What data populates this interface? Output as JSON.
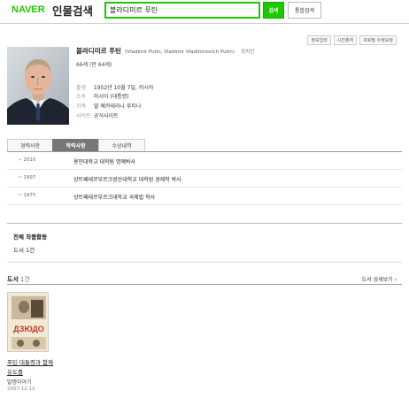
{
  "header": {
    "logo": "NAVER",
    "service": "인물검색",
    "search_value": "블라디미르 푸틴",
    "search_button": "검색",
    "total_button": "통합검색"
  },
  "top_links": [
    "정보입력",
    "시진출처",
    "프로필 수정요청"
  ],
  "profile": {
    "name": "블라디미르 푸틴",
    "name_en": "(Vladimir Putin, Vladimir Vladimirovich Putin)",
    "job": "정치인",
    "age": "66세 (만 64세)",
    "info": [
      {
        "label": "출생",
        "value": "1952년 10월 7일, 러시아"
      },
      {
        "label": "소속",
        "value": "러시아 (대통령)"
      },
      {
        "label": "가족",
        "value": "딸 예카테리나 푸티나"
      },
      {
        "label": "사이트",
        "value": "공식사이트"
      }
    ]
  },
  "tabs": [
    {
      "label": "경력사항",
      "active": false
    },
    {
      "label": "학력사항",
      "active": true
    },
    {
      "label": "수상내역",
      "active": false
    }
  ],
  "education": [
    {
      "year": "~ 2010",
      "desc": "용인대학교 대학원 명예박사"
    },
    {
      "year": "~ 1997",
      "desc": "상트페테르부르크광산대학교 대학원 경제학 박사"
    },
    {
      "year": "~ 1975",
      "desc": "상트페테르부르크대학교 국제법 학사"
    }
  ],
  "works": {
    "title": "전체 작품활동",
    "count": "도서 1건"
  },
  "books": {
    "title": "도서",
    "count": "1건",
    "more": "도서 상세보기",
    "items": [
      {
        "cover_text": "ДЗЮДО",
        "title_line1": "푸틴 대통령과 함께",
        "title_line2": "유도를",
        "publisher": "말명이야기",
        "date": "2007.12.12"
      }
    ]
  },
  "colors": {
    "brand_green": "#1ec800",
    "active_tab": "#777777",
    "cover_red": "#c0392b"
  }
}
